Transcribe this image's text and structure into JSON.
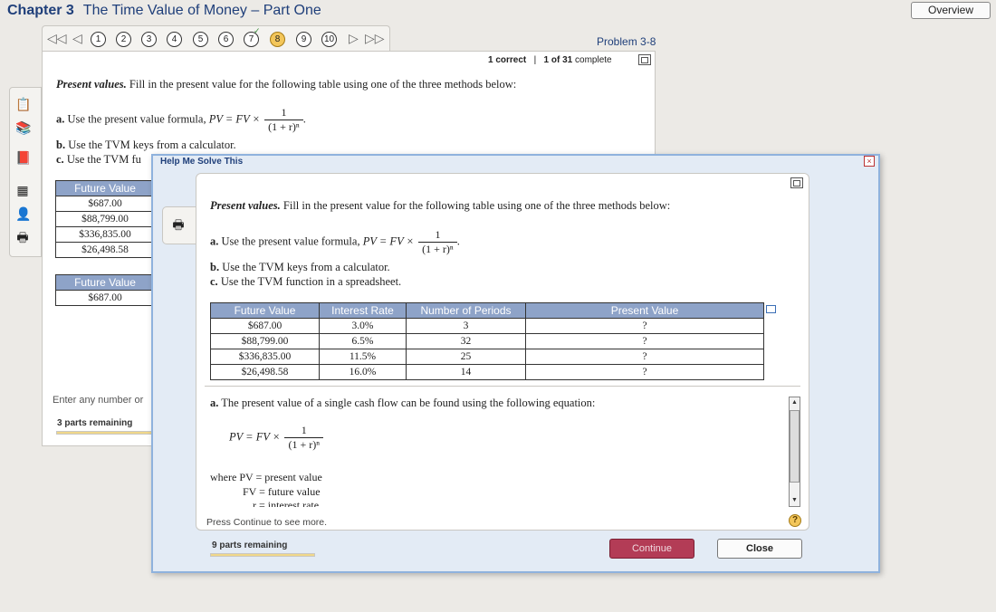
{
  "header": {
    "chapter_label": "Chapter 3",
    "chapter_title": "The Time Value of Money – Part One",
    "overview_label": "Overview"
  },
  "nav": {
    "numbers": [
      "1",
      "2",
      "3",
      "4",
      "5",
      "6",
      "7",
      "8",
      "9",
      "10"
    ],
    "current": "8",
    "checked": "7",
    "problem_id": "Problem 3-8"
  },
  "status": {
    "correct": "1 correct",
    "separator": "|",
    "complete_count": "1 of 31",
    "complete_label": "complete"
  },
  "problem": {
    "title": "Present values.",
    "instruction": "Fill in the present value for the following table using one of the three methods below:",
    "method_a_label": "a.",
    "method_a_text": "Use the present value formula,",
    "formula_lhs": "PV = FV ×",
    "formula_num": "1",
    "formula_den": "(1 + r)ⁿ",
    "method_b_label": "b.",
    "method_b_text": "Use the TVM keys from a calculator.",
    "method_c_label": "c.",
    "method_c_text": "Use the TVM function in a spreadsheet.",
    "method_c_truncated": "Use the TVM fu"
  },
  "back_table": {
    "header": "Future Value",
    "rows": [
      "$687.00",
      "$88,799.00",
      "$336,835.00",
      "$26,498.58"
    ]
  },
  "back_table2": {
    "header": "Future Value",
    "rows": [
      "$687.00"
    ]
  },
  "back_footer": {
    "input_hint": "Enter any number or",
    "parts_remaining": "3 parts remaining",
    "progress": 0
  },
  "dialog": {
    "title": "Help Me Solve This",
    "close_symbol": "×",
    "table": {
      "headers": [
        "Future Value",
        "Interest Rate",
        "Number of Periods",
        "Present Value"
      ],
      "rows": [
        [
          "$687.00",
          "3.0%",
          "3",
          "?"
        ],
        [
          "$88,799.00",
          "6.5%",
          "32",
          "?"
        ],
        [
          "$336,835.00",
          "11.5%",
          "25",
          "?"
        ],
        [
          "$26,498.58",
          "16.0%",
          "14",
          "?"
        ]
      ]
    },
    "explanation": {
      "label": "a.",
      "text": "The present value of a single cash flow can be found using the following equation:",
      "where_line": "where PV = present value",
      "fv_line": "FV = future value",
      "r_line": "r = interest rate"
    },
    "continue_note": "Press Continue to see more.",
    "help_symbol": "?",
    "parts_remaining": "9 parts remaining",
    "progress": 0,
    "continue_label": "Continue",
    "close_label": "Close"
  },
  "colors": {
    "accent": "#1f3f7a",
    "table_header": "#8ea3c8",
    "continue_button": "#b33c56",
    "current_problem": "#f3c65a"
  }
}
